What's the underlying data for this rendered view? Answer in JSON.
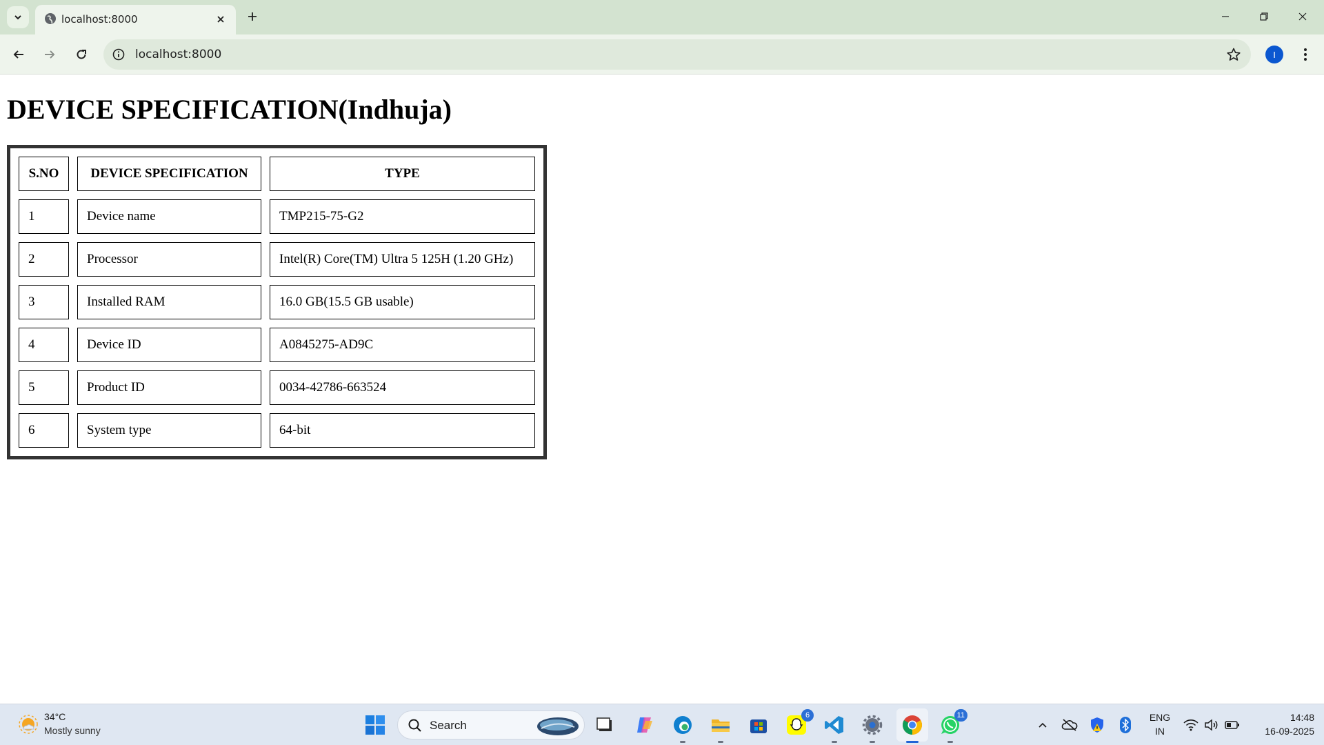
{
  "browser": {
    "tab_title": "localhost:8000",
    "url": "localhost:8000",
    "profile_initial": "I"
  },
  "page": {
    "title": "DEVICE SPECIFICATION(Indhuja)",
    "table": {
      "headers": [
        "S.NO",
        "DEVICE SPECIFICATION",
        "TYPE"
      ],
      "rows": [
        [
          "1",
          "Device name",
          "TMP215-75-G2"
        ],
        [
          "2",
          "Processor",
          "Intel(R) Core(TM) Ultra 5 125H (1.20 GHz)"
        ],
        [
          "3",
          "Installed RAM",
          "16.0 GB(15.5 GB usable)"
        ],
        [
          "4",
          "Device ID",
          "A0845275-AD9C"
        ],
        [
          "5",
          "Product ID",
          "0034-42786-663524"
        ],
        [
          "6",
          "System type",
          "64-bit"
        ]
      ]
    }
  },
  "taskbar": {
    "weather": {
      "temp": "34°C",
      "desc": "Mostly sunny"
    },
    "search_label": "Search",
    "snapchat_badge": "6",
    "whatsapp_badge": "11",
    "lang_primary": "ENG",
    "lang_secondary": "IN",
    "time": "14:48",
    "date": "16-09-2025"
  },
  "colors": {
    "tab_strip": "#d3e3d0",
    "toolbar": "#eef4ec",
    "omnibox": "#dfe9dc",
    "table_frame": "#333333",
    "taskbar": "#dfe7f2",
    "accent": "#0b57d0"
  }
}
